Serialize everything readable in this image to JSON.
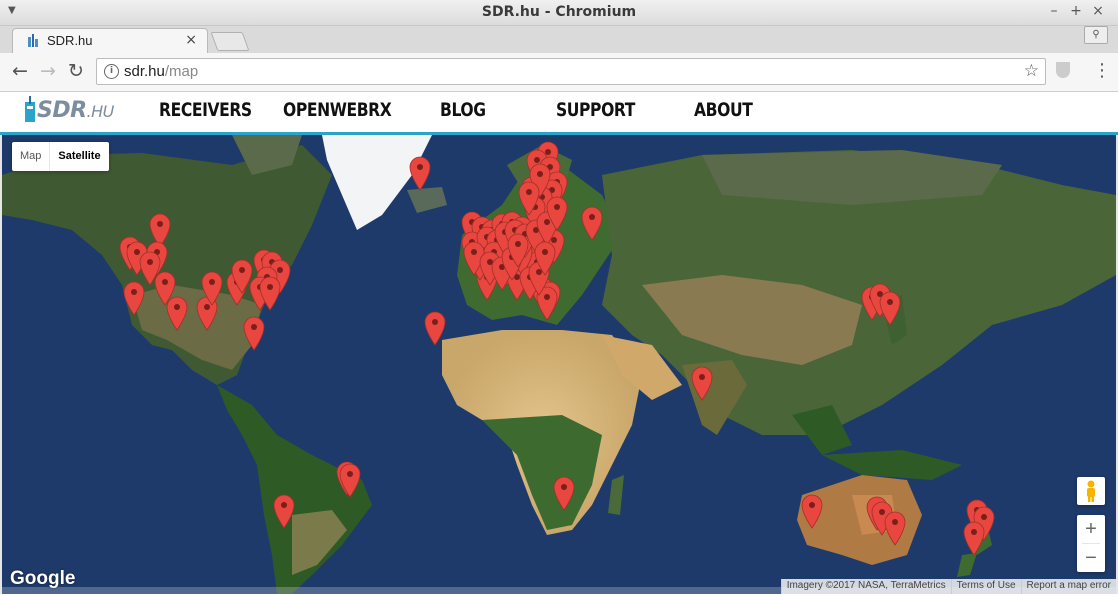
{
  "window": {
    "title": "SDR.hu - Chromium"
  },
  "tab": {
    "title": "SDR.hu"
  },
  "address": {
    "host": "sdr.hu",
    "path": "/map"
  },
  "site": {
    "logo_main": "SDR",
    "logo_suffix": ".HU",
    "nav": [
      "RECEIVERS",
      "OPENWEBRX",
      "BLOG",
      "SUPPORT",
      "ABOUT"
    ]
  },
  "map": {
    "type_buttons": {
      "map": "Map",
      "satellite": "Satellite",
      "selected": "satellite"
    },
    "zoom_in": "+",
    "zoom_out": "−",
    "google_logo": "Google",
    "attribution": {
      "imagery": "Imagery ©2017 NASA, TerraMetrics",
      "terms": "Terms of Use",
      "report": "Report a map error"
    },
    "marker_color": "#e8463f",
    "marker_count": 120
  },
  "colors": {
    "accent": "#2aa4c8",
    "ocean": "#1e3a6b"
  },
  "icons": [
    "back-arrow-icon",
    "forward-arrow-icon",
    "reload-icon",
    "info-icon",
    "star-icon",
    "shield-extension-icon",
    "menu-icon",
    "pegman-icon",
    "map-marker-icon"
  ]
}
